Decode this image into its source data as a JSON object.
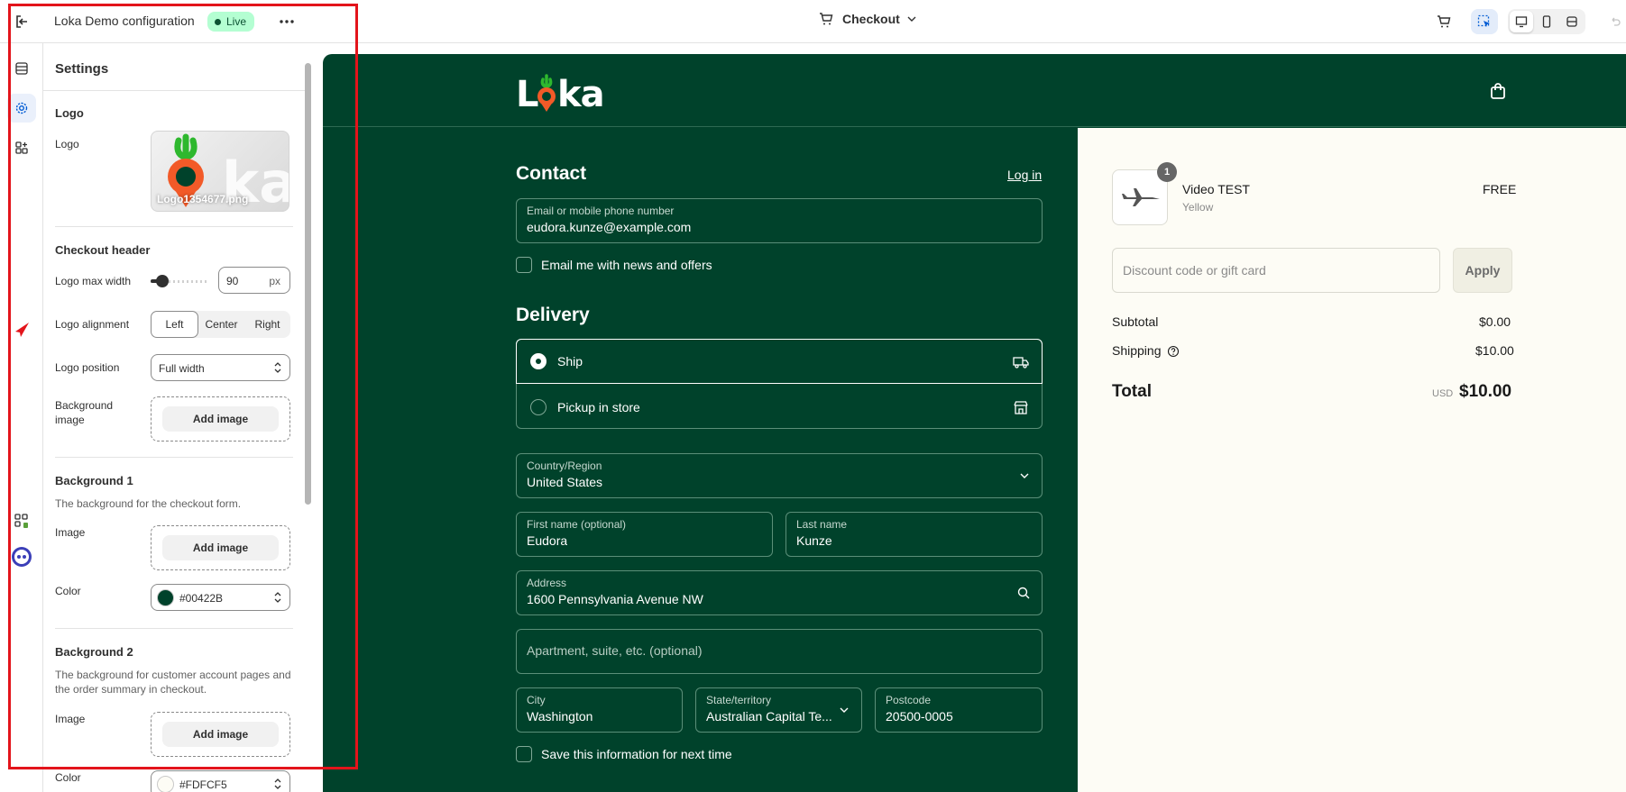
{
  "topbar": {
    "app_title": "Loka Demo configuration",
    "status_badge": "Live",
    "page_selector": "Checkout"
  },
  "settings": {
    "heading": "Settings",
    "logo_section": {
      "title": "Logo",
      "label": "Logo",
      "filename": "Logo1354677.png"
    },
    "checkout_header": {
      "title": "Checkout header",
      "max_width_label": "Logo max width",
      "max_width_value": "90",
      "max_width_unit": "px",
      "alignment_label": "Logo alignment",
      "alignment_options": [
        "Left",
        "Center",
        "Right"
      ],
      "alignment_selected": "Left",
      "position_label": "Logo position",
      "position_value": "Full width",
      "bg_image_label": "Background image",
      "add_image": "Add image"
    },
    "background1": {
      "title": "Background 1",
      "description": "The background for the checkout form.",
      "image_label": "Image",
      "add_image": "Add image",
      "color_label": "Color",
      "color_value": "#00422B"
    },
    "background2": {
      "title": "Background 2",
      "description": "The background for customer account pages and the order summary in checkout.",
      "image_label": "Image",
      "add_image": "Add image",
      "color_label": "Color",
      "color_value": "#FDFCF5"
    }
  },
  "preview": {
    "brand": "Loka",
    "contact": {
      "title": "Contact",
      "login": "Log in",
      "email_label": "Email or mobile phone number",
      "email_value": "eudora.kunze@example.com",
      "news_checkbox": "Email me with news and offers"
    },
    "delivery": {
      "title": "Delivery",
      "ship": "Ship",
      "pickup": "Pickup in store",
      "country_label": "Country/Region",
      "country_value": "United States",
      "first_label": "First name (optional)",
      "first_value": "Eudora",
      "last_label": "Last name",
      "last_value": "Kunze",
      "address_label": "Address",
      "address_value": "1600 Pennsylvania Avenue NW",
      "apt_placeholder": "Apartment, suite, etc. (optional)",
      "city_label": "City",
      "city_value": "Washington",
      "state_label": "State/territory",
      "state_value": "Australian Capital Te...",
      "postcode_label": "Postcode",
      "postcode_value": "20500-0005",
      "save_checkbox": "Save this information for next time"
    },
    "summary": {
      "qty": "1",
      "item_name": "Video TEST",
      "item_variant": "Yellow",
      "item_price": "FREE",
      "discount_placeholder": "Discount code or gift card",
      "apply": "Apply",
      "subtotal_label": "Subtotal",
      "subtotal_value": "$0.00",
      "shipping_label": "Shipping",
      "shipping_value": "$10.00",
      "total_label": "Total",
      "total_currency": "USD",
      "total_value": "$10.00"
    }
  },
  "colors": {
    "checkout_bg": "#00422b",
    "summary_bg": "#fdfcf5",
    "highlight_box": "#e3141b",
    "live_badge": "#b4fed2"
  }
}
